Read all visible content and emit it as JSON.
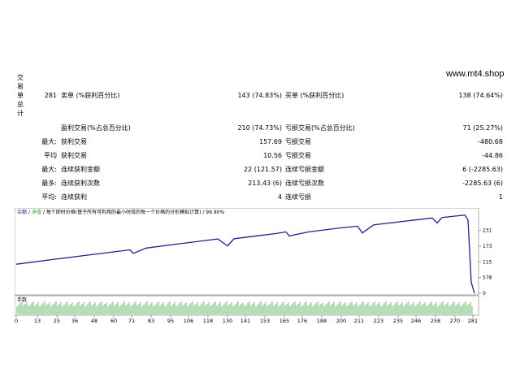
{
  "watermark": "www.mt4.shop",
  "section_label": [
    "交",
    "易",
    "单",
    "总",
    "计"
  ],
  "rows": [
    {
      "l1": "",
      "l1v": "281",
      "lbl1": "卖单 (%获利百分比)",
      "v1": "143 (74.83%)",
      "lbl2": "买单 (%获利百分比)",
      "v2": "138 (74.64%)"
    },
    {
      "l1": "",
      "l1v": "",
      "lbl1": "盈利交易(%占总百分比)",
      "v1": "210 (74.73%)",
      "lbl2": "亏损交易(%占总百分比)",
      "v2": "71 (25.27%)"
    },
    {
      "l1": "最大:",
      "l1v": "",
      "lbl1": "获利交易",
      "v1": "157.69",
      "lbl2": "亏损交易",
      "v2": "-480.68"
    },
    {
      "l1": "平均",
      "l1v": "",
      "lbl1": "获利交易",
      "v1": "10.56",
      "lbl2": "亏损交易",
      "v2": "-44.86"
    },
    {
      "l1": "最大:",
      "l1v": "",
      "lbl1": "连续获利金额",
      "v1": "22 (121.57)",
      "lbl2": "连续亏损金额",
      "v2": "6 (-2285.63)"
    },
    {
      "l1": "最多:",
      "l1v": "",
      "lbl1": "连续获利次数",
      "v1": "213.43 (6)",
      "lbl2": "连续亏损次数",
      "v2": "-2285.63 (6)"
    },
    {
      "l1": "平均:",
      "l1v": "",
      "lbl1": "连续获利",
      "v1": "4",
      "lbl2": "连续亏损",
      "v2": "1"
    }
  ],
  "chart": {
    "legend": [
      "余额",
      "净值",
      "每个即时价格(基于所有可利用的最小时段的每一个价格的分形模拟计算)",
      "99.90%"
    ],
    "volume_label": "手数",
    "y_ticks": [
      "2312",
      "1734",
      "1156",
      "578",
      "0"
    ],
    "x_ticks": [
      "0",
      "13",
      "25",
      "36",
      "48",
      "60",
      "71",
      "83",
      "95",
      "106",
      "118",
      "130",
      "141",
      "153",
      "165",
      "176",
      "188",
      "200",
      "211",
      "223",
      "235",
      "246",
      "258",
      "270",
      "281"
    ],
    "colors": {
      "balance": "#1f1f8f",
      "volume": "#2e9e2e",
      "frame": "#888888"
    }
  },
  "chart_data": {
    "type": "line",
    "series": [
      {
        "name": "余额",
        "x": [
          0,
          20,
          40,
          60,
          70,
          72,
          80,
          100,
          110,
          124,
          130,
          134,
          140,
          160,
          166,
          168,
          180,
          200,
          210,
          213,
          220,
          240,
          256,
          259,
          262,
          270,
          276,
          278,
          280,
          282
        ],
        "values": [
          1070,
          1225,
          1375,
          1525,
          1600,
          1470,
          1665,
          1820,
          1895,
          2000,
          1745,
          2005,
          2055,
          2200,
          2260,
          2110,
          2260,
          2410,
          2470,
          2220,
          2520,
          2660,
          2770,
          2590,
          2790,
          2840,
          2880,
          2700,
          400,
          0
        ]
      }
    ],
    "x_ticks": [
      0,
      13,
      25,
      36,
      48,
      60,
      71,
      83,
      95,
      106,
      118,
      130,
      141,
      153,
      165,
      176,
      188,
      200,
      211,
      223,
      235,
      246,
      258,
      270,
      281
    ],
    "y_ticks": [
      0,
      578,
      1156,
      1734,
      2312
    ],
    "xlim": [
      0,
      283
    ],
    "ylim": [
      0,
      2900
    ]
  }
}
